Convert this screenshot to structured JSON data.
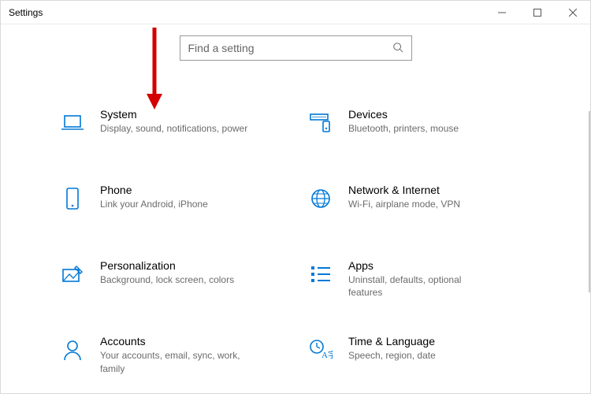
{
  "window": {
    "title": "Settings"
  },
  "search": {
    "placeholder": "Find a setting"
  },
  "tiles": [
    {
      "name": "System",
      "desc": "Display, sound, notifications, power"
    },
    {
      "name": "Devices",
      "desc": "Bluetooth, printers, mouse"
    },
    {
      "name": "Phone",
      "desc": "Link your Android, iPhone"
    },
    {
      "name": "Network & Internet",
      "desc": "Wi-Fi, airplane mode, VPN"
    },
    {
      "name": "Personalization",
      "desc": "Background, lock screen, colors"
    },
    {
      "name": "Apps",
      "desc": "Uninstall, defaults, optional features"
    },
    {
      "name": "Accounts",
      "desc": "Your accounts, email, sync, work, family"
    },
    {
      "name": "Time & Language",
      "desc": "Speech, region, date"
    }
  ],
  "colors": {
    "accent": "#0078d7"
  }
}
